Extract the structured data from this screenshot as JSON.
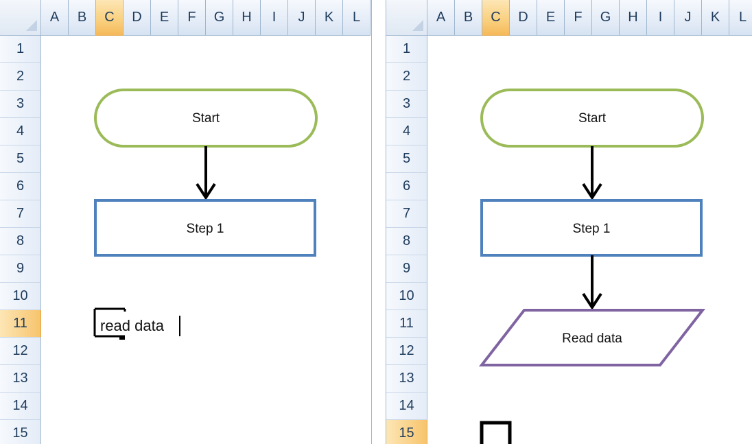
{
  "columns": [
    "A",
    "B",
    "C",
    "D",
    "E",
    "F",
    "G",
    "H",
    "I",
    "J",
    "K",
    "L"
  ],
  "rows": [
    "1",
    "2",
    "3",
    "4",
    "5",
    "6",
    "7",
    "8",
    "9",
    "10",
    "11",
    "12",
    "13",
    "14",
    "15"
  ],
  "left": {
    "start_label": "Start",
    "step1_label": "Step 1",
    "editing_text": "read data"
  },
  "right": {
    "start_label": "Start",
    "step1_label": "Step 1",
    "read_label": "Read data"
  },
  "colors": {
    "terminator_stroke": "#9bbb59",
    "process_stroke": "#4f81bd",
    "io_stroke": "#8064a2",
    "header_selected": "#f9cf7d"
  }
}
